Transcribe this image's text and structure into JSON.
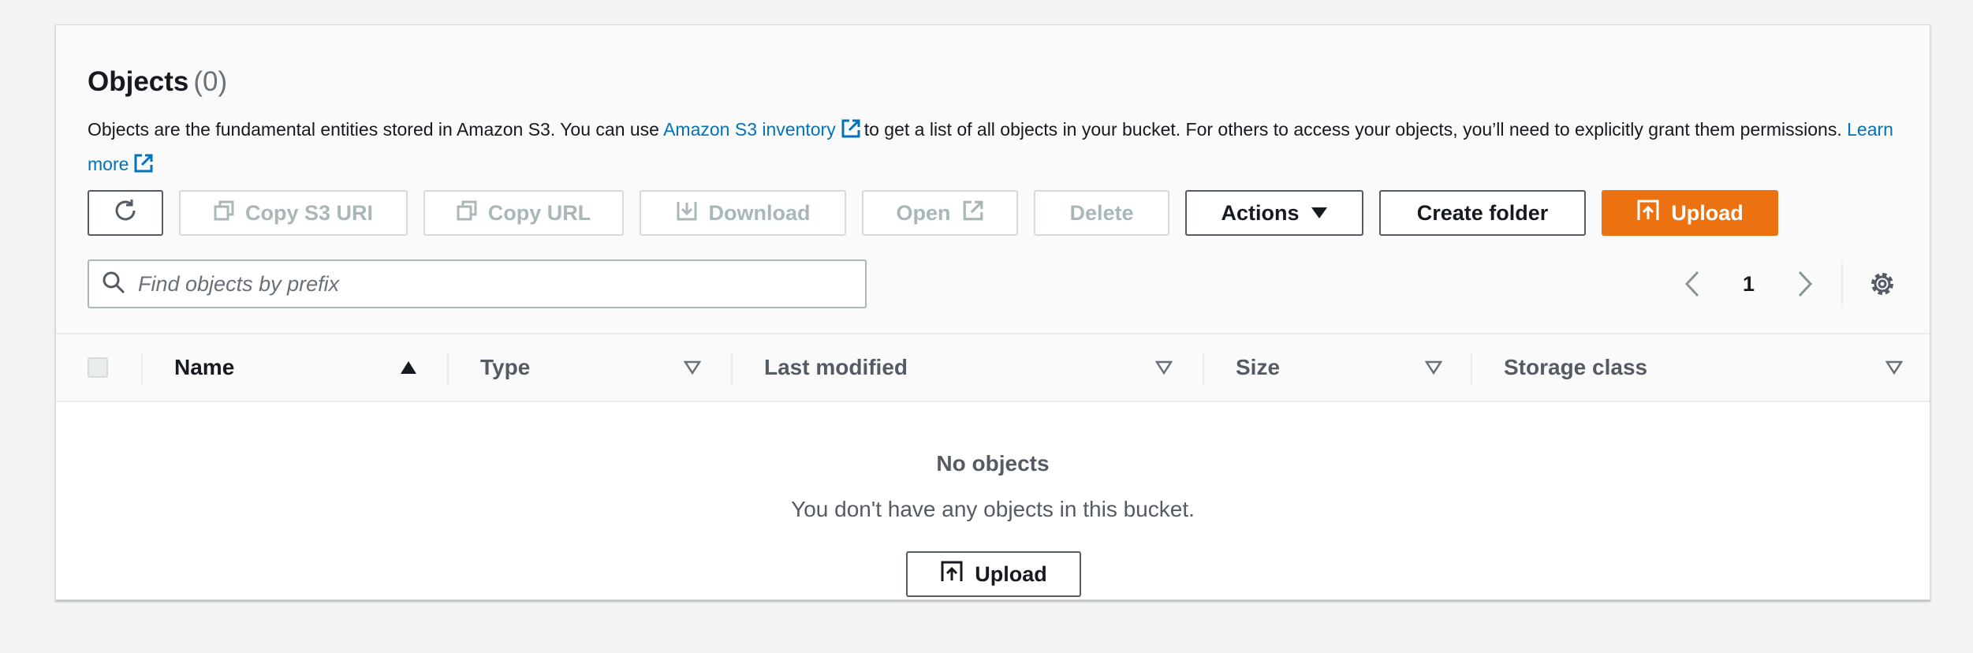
{
  "header": {
    "title": "Objects",
    "count": "(0)",
    "desc_part1": "Objects are the fundamental entities stored in Amazon S3. You can use ",
    "inventory_link": "Amazon S3 inventory",
    "desc_part2": "to get a list of all objects in your bucket. For others to access your objects, you’ll need to explicitly grant them permissions.",
    "learn_more": "Learn more"
  },
  "toolbar": {
    "copy_s3_uri": "Copy S3 URI",
    "copy_url": "Copy URL",
    "download": "Download",
    "open": "Open",
    "delete": "Delete",
    "actions": "Actions",
    "create_folder": "Create folder",
    "upload": "Upload"
  },
  "search": {
    "placeholder": "Find objects by prefix"
  },
  "pagination": {
    "current_page": "1"
  },
  "table": {
    "columns": {
      "name": "Name",
      "type": "Type",
      "last_modified": "Last modified",
      "size": "Size",
      "storage_class": "Storage class"
    },
    "empty_title": "No objects",
    "empty_text": "You don't have any objects in this bucket.",
    "empty_upload": "Upload"
  },
  "colors": {
    "accent": "#ec7211",
    "link": "#0073bb",
    "text": "#16191f",
    "muted": "#545b64"
  }
}
